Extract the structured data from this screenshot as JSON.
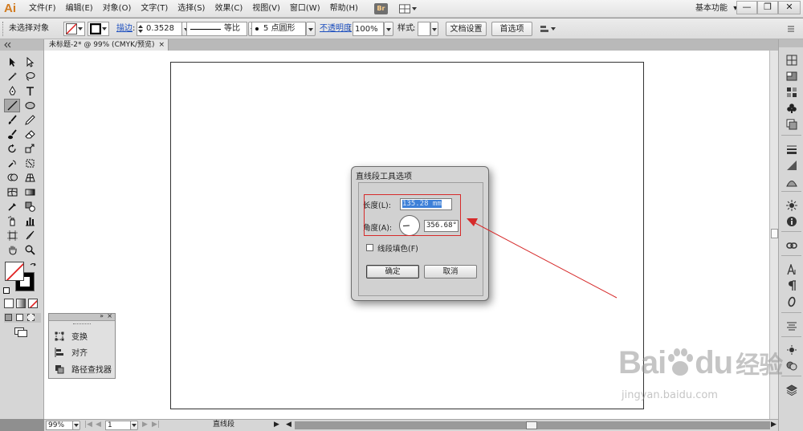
{
  "app": {
    "logo": "Ai"
  },
  "menu": [
    "文件(F)",
    "编辑(E)",
    "对象(O)",
    "文字(T)",
    "选择(S)",
    "效果(C)",
    "视图(V)",
    "窗口(W)",
    "帮助(H)"
  ],
  "menubar_extra": {
    "bridge": "Br",
    "workspace": "基本功能",
    "workspace_arrow": "▾",
    "minimize": "—",
    "restore": "❐",
    "close": "✕"
  },
  "control": {
    "selection": "未选择对象",
    "stroke_label": "描边",
    "stroke_value": "0.3528",
    "profile": "等比",
    "brush": "5 点圆形",
    "opacity_label": "不透明度",
    "opacity_value": "100%",
    "style_label": "样式",
    "doc_setup": "文档设置",
    "preferences": "首选项"
  },
  "document": {
    "tab": "未标题-2* @ 99% (CMYK/预览)",
    "close": "×"
  },
  "status": {
    "zoom": "99%",
    "artboard": "1",
    "tool": "直线段"
  },
  "float_panel": {
    "items": [
      "变换",
      "对齐",
      "路径查找器"
    ]
  },
  "dialog": {
    "title": "直线段工具选项",
    "length_label": "长度(L):",
    "length_value": "135.28 mm",
    "angle_label": "角度(A):",
    "angle_value": "356.68°",
    "fill_label": "线段填色(F)",
    "ok": "确定",
    "cancel": "取消"
  },
  "annotation": {
    "color": "#d62a2a"
  },
  "watermark": {
    "brand": "Bai",
    "brand2": "du",
    "cn": "经验",
    "url": "jingyan.baidu.com"
  }
}
